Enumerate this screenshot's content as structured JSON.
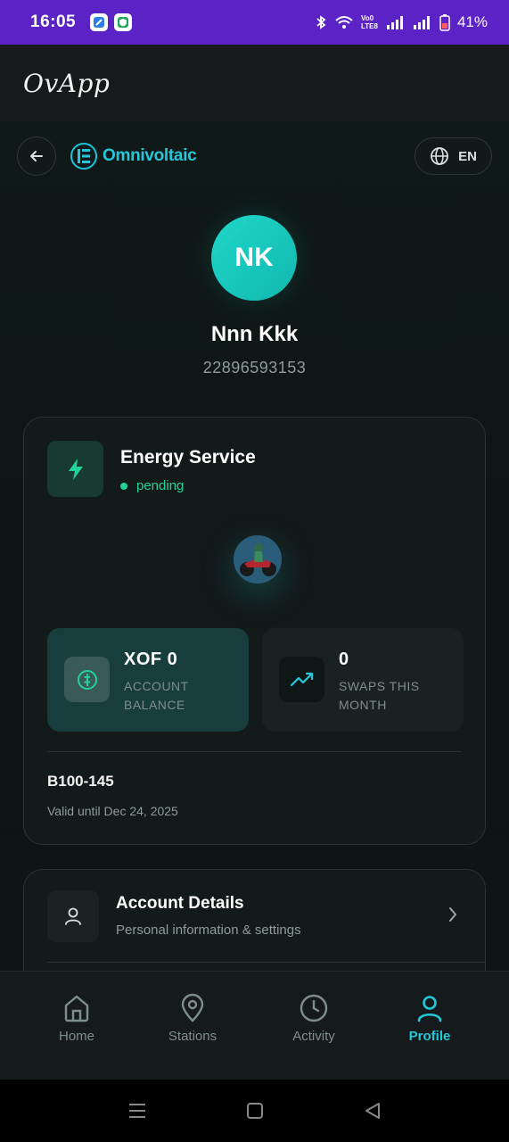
{
  "status_bar": {
    "time": "16:05",
    "battery": "41%",
    "net_label": "Vo0 LTE8",
    "app_icons": [
      "mail-icon",
      "shield-icon"
    ]
  },
  "app_bar": {
    "title": "OvApp"
  },
  "header": {
    "brand_name": "Omnivoltaic",
    "language": "EN"
  },
  "profile": {
    "initials": "NK",
    "name": "Nnn Kkk",
    "phone": "22896593153"
  },
  "energy_service": {
    "title": "Energy Service",
    "status": "pending",
    "balance": {
      "value": "XOF  0",
      "label": "ACCOUNT BALANCE"
    },
    "swaps": {
      "value": "0",
      "label": "SWAPS THIS MONTH"
    },
    "plan_code": "B100-145",
    "valid_until": "Valid until Dec 24, 2025"
  },
  "account_details": {
    "title": "Account Details",
    "subtitle": "Personal information & settings"
  },
  "bottom_nav": [
    {
      "label": "Home",
      "icon": "home-icon",
      "active": false
    },
    {
      "label": "Stations",
      "icon": "map-pin-icon",
      "active": false
    },
    {
      "label": "Activity",
      "icon": "clock-icon",
      "active": false
    },
    {
      "label": "Profile",
      "icon": "user-icon",
      "active": true
    }
  ],
  "colors": {
    "accent": "#22c8d8",
    "success": "#23d19b",
    "status_bar": "#5b23c6"
  }
}
